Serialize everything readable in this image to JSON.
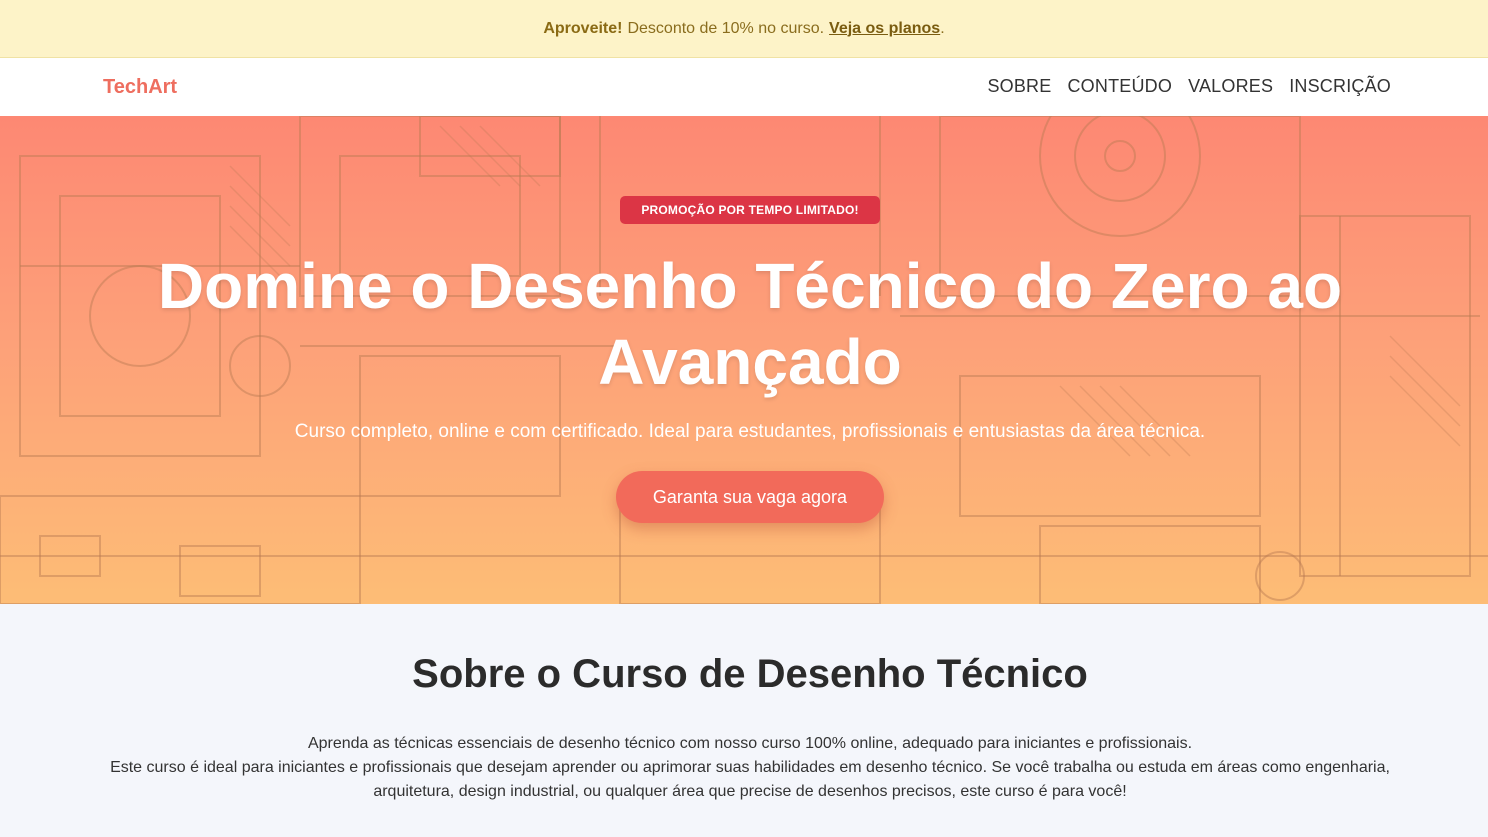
{
  "promo": {
    "highlight": "Aproveite!",
    "text": "Desconto de 10% no curso.",
    "link": "Veja os planos",
    "suffix": "."
  },
  "nav": {
    "brand": "TechArt",
    "links": [
      "SOBRE",
      "CONTEÚDO",
      "VALORES",
      "INSCRIÇÃO"
    ]
  },
  "hero": {
    "badge": "PROMOÇÃO POR TEMPO LIMITADO!",
    "title_line1": "Domine o Desenho Técnico do Zero ao",
    "title_line2": "Avançado",
    "subtitle": "Curso completo, online e com certificado. Ideal para estudantes, profissionais e entusiastas da área técnica.",
    "cta": "Garanta sua vaga agora",
    "background_image": "technical-drawing-sketch"
  },
  "about": {
    "title": "Sobre o Curso de Desenho Técnico",
    "line1": "Aprenda as técnicas essenciais de desenho técnico com nosso curso 100% online, adequado para iniciantes e profissionais.",
    "line2": "Este curso é ideal para iniciantes e profissionais que desejam aprender ou aprimorar suas habilidades em desenho técnico. Se você trabalha ou estuda em áreas como engenharia, arquitetura, design industrial, ou qualquer área que precise de desenhos precisos, este curso é para você!"
  },
  "colors": {
    "accent": "#ee6e5f",
    "badge": "#dc3545",
    "promo_bg": "#fdf3c8",
    "hero_top": "#fd8873",
    "hero_bottom": "#fdbd76"
  }
}
